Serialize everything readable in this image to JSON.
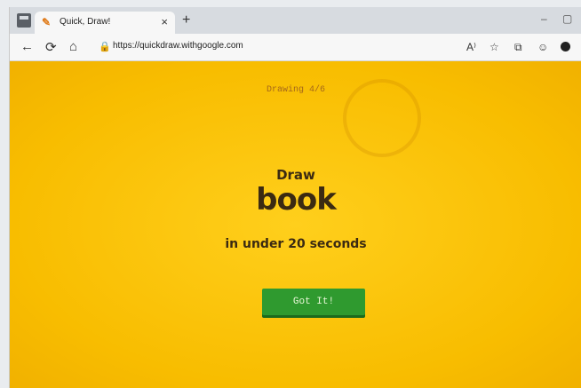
{
  "browser": {
    "tab": {
      "title": "Quick, Draw!",
      "favicon": "quickdraw-icon",
      "close": "×"
    },
    "new_tab": "+",
    "address": {
      "url": "https://quickdraw.withgoogle.com"
    },
    "window_controls": {
      "minimize": "–",
      "maximize": "▢"
    },
    "nav": {
      "back": "←",
      "reload": "⟳",
      "home": "⌂",
      "lock": "🔒"
    },
    "toolbar_icons": [
      "A⁾",
      "☆",
      "⧉",
      "☺"
    ]
  },
  "page": {
    "counter": "Drawing 4/6",
    "draw_label": "Draw",
    "word": "book",
    "time_text": "in under 20 seconds",
    "button_label": "Got It!",
    "background_color": "#f8bd00",
    "button_color": "#2f9a2f"
  }
}
